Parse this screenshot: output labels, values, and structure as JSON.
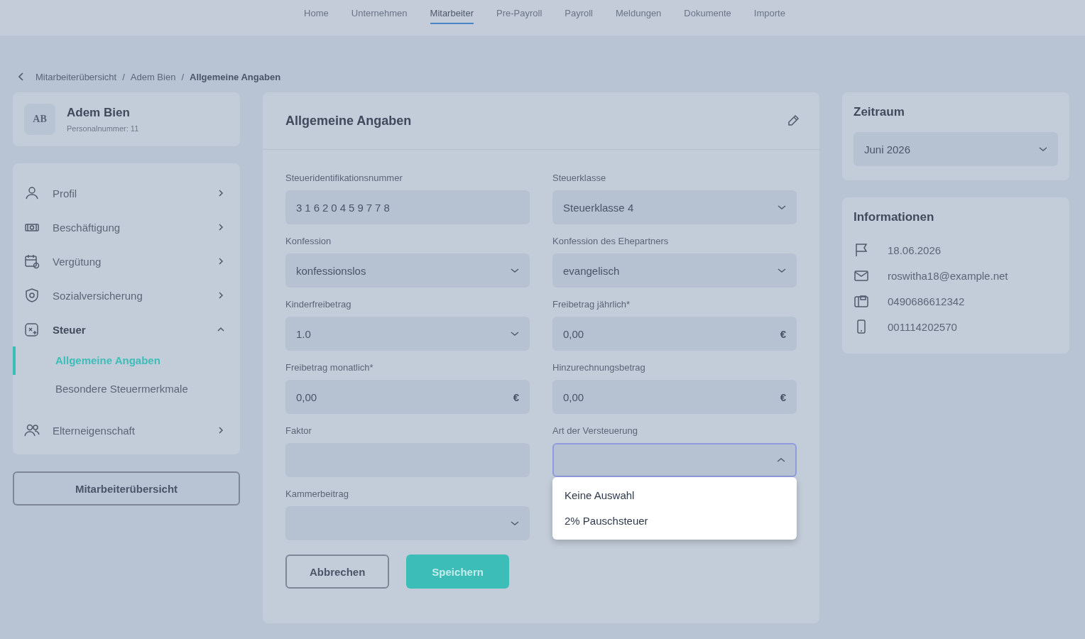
{
  "nav": [
    {
      "label": "Home",
      "selected": false
    },
    {
      "label": "Unternehmen",
      "selected": false
    },
    {
      "label": "Mitarbeiter",
      "selected": true
    },
    {
      "label": "Pre-Payroll",
      "selected": false
    },
    {
      "label": "Payroll",
      "selected": false
    },
    {
      "label": "Meldungen",
      "selected": false
    },
    {
      "label": "Dokumente",
      "selected": false
    },
    {
      "label": "Importe",
      "selected": false
    }
  ],
  "breadcrumb": {
    "separator": "/",
    "items": [
      "Mitarbeiterübersicht",
      "Adem Bien",
      "Allgemeine Angaben"
    ]
  },
  "employee": {
    "initials": "AB",
    "name": "Adem Bien",
    "number_label": "Personalnummer:",
    "number": "11"
  },
  "sidebar": {
    "items": [
      {
        "kind": "person",
        "label": "Profil",
        "expanded": false
      },
      {
        "kind": "money",
        "label": "Beschäftigung",
        "expanded": false
      },
      {
        "kind": "calendar",
        "label": "Vergütung",
        "expanded": false
      },
      {
        "kind": "shield",
        "label": "Sozialversicherung",
        "expanded": false
      },
      {
        "kind": "tax",
        "label": "Steuer",
        "expanded": true,
        "children": [
          {
            "label": "Allgemeine Angaben",
            "selected": true
          },
          {
            "label": "Besondere Steuermerkmale",
            "selected": false
          }
        ]
      },
      {
        "kind": "people",
        "label": "Elterneigenschaft",
        "expanded": false
      }
    ],
    "button": "Mitarbeiterübersicht"
  },
  "form": {
    "title": "Allgemeine Angaben",
    "fields": [
      {
        "label": "Steueridentifikationsnummer",
        "kind": "id",
        "value": "31620459778"
      },
      {
        "label": "Steuerklasse",
        "kind": "select",
        "value": "Steuerklasse 4"
      },
      {
        "label": "Konfession",
        "kind": "select",
        "value": "konfessionslos"
      },
      {
        "label": "Konfession des Ehepartners",
        "kind": "select",
        "value": "evangelisch"
      },
      {
        "label": "Kinderfreibetrag",
        "kind": "select",
        "value": "1.0"
      },
      {
        "label": "Freibetrag jährlich*",
        "kind": "currency",
        "value": "0,00",
        "unit": "€"
      },
      {
        "label": "Freibetrag monatlich*",
        "kind": "currency",
        "value": "0,00",
        "unit": "€"
      },
      {
        "label": "Hinzurechnungsbetrag",
        "kind": "currency",
        "value": "0,00",
        "unit": "€"
      },
      {
        "label": "Faktor",
        "kind": "text"
      },
      {
        "label": "Art der Versteuerung",
        "kind": "select",
        "open": true,
        "options": [
          "Keine Auswahl",
          "2% Pauschsteuer"
        ]
      },
      {
        "label": "Kammerbeitrag",
        "kind": "select"
      }
    ],
    "buttons": [
      {
        "label": "Abbrechen",
        "kind": "secondary"
      },
      {
        "label": "Speichern",
        "kind": "primary"
      }
    ]
  },
  "period": {
    "title": "Zeitraum",
    "value": "Juni 2026"
  },
  "info": {
    "title": "Informationen",
    "items": [
      {
        "kind": "flag",
        "text": "18.06.2026"
      },
      {
        "kind": "mail",
        "text": "roswitha18@example.net"
      },
      {
        "kind": "phone",
        "text": "0490686612342"
      },
      {
        "kind": "mobile",
        "text": "001114202570"
      }
    ]
  }
}
